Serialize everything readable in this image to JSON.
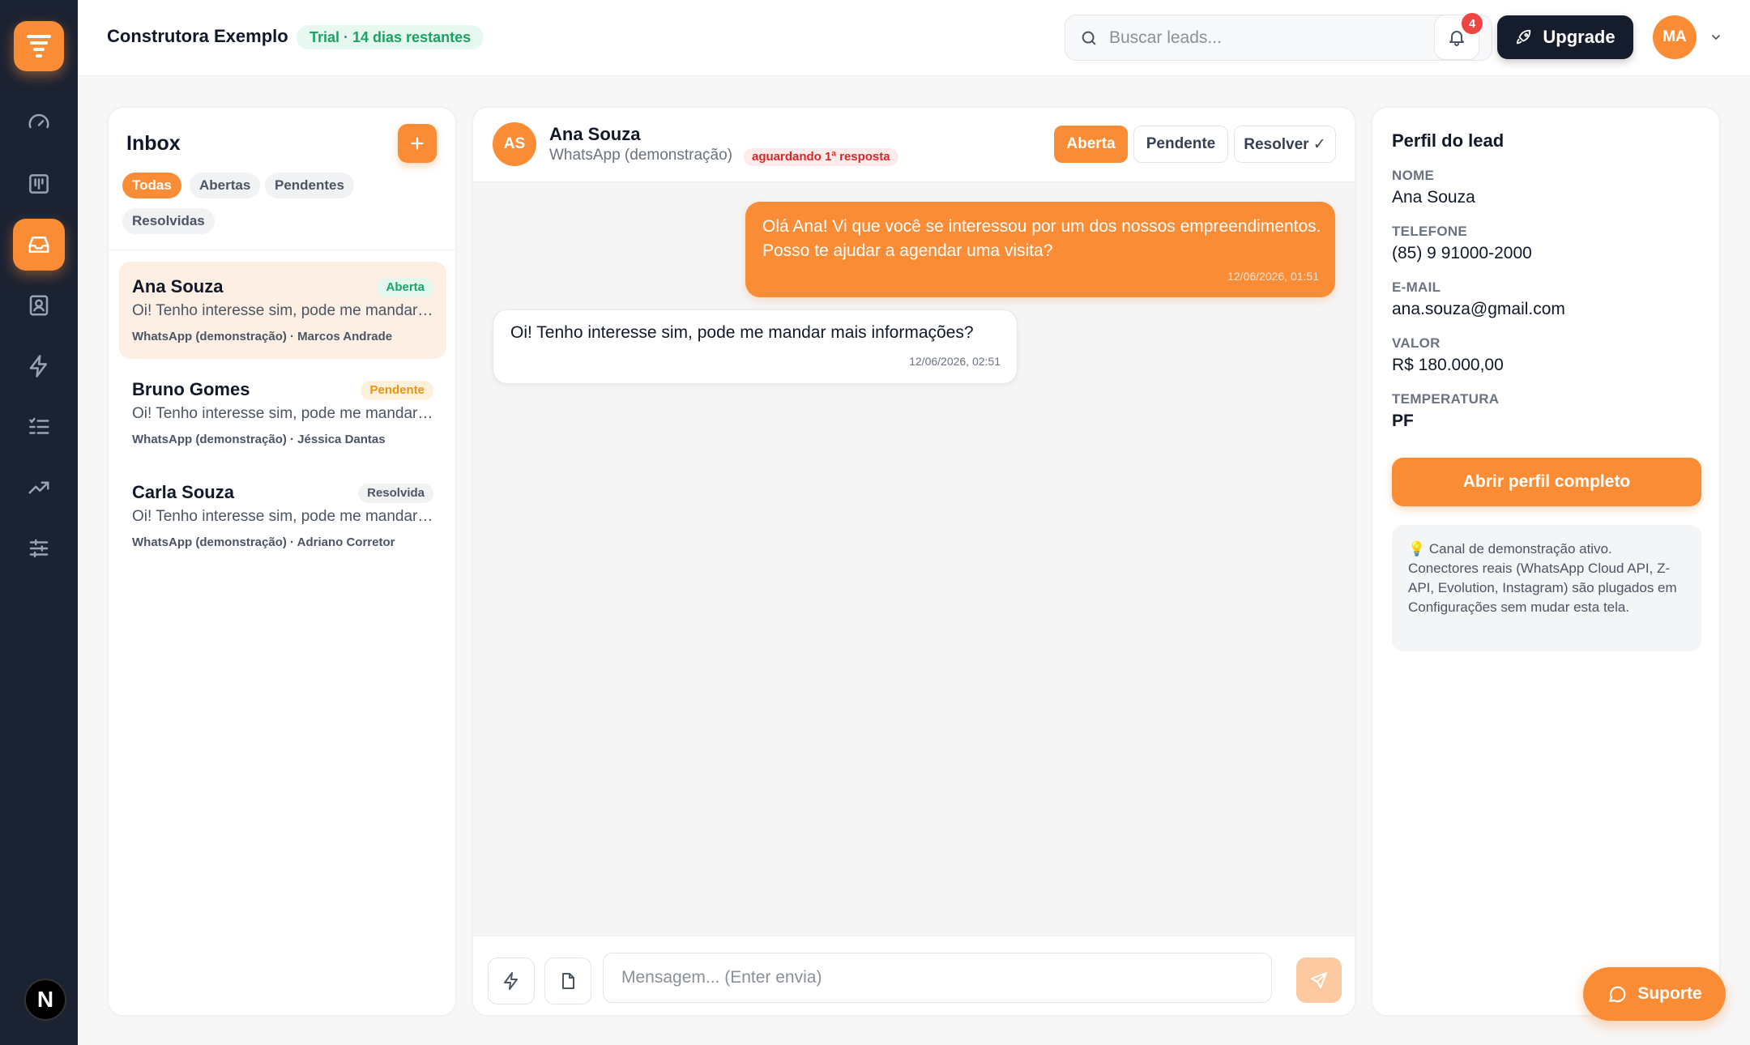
{
  "header": {
    "company": "Construtora Exemplo",
    "trial_badge": "Trial · 14 dias restantes",
    "search_placeholder": "Buscar leads...",
    "notifications_count": "4",
    "upgrade_label": "Upgrade",
    "user_initials": "MA"
  },
  "sidebar": {
    "items": [
      {
        "icon": "gauge-icon"
      },
      {
        "icon": "kanban-icon"
      },
      {
        "icon": "inbox-icon",
        "active": true
      },
      {
        "icon": "contacts-icon"
      },
      {
        "icon": "lightning-icon"
      },
      {
        "icon": "checklist-icon"
      },
      {
        "icon": "trending-up-icon"
      },
      {
        "icon": "sliders-icon"
      }
    ],
    "bottom_badge": "N"
  },
  "inbox": {
    "title": "Inbox",
    "filters": [
      "Todas",
      "Abertas",
      "Pendentes",
      "Resolvidas"
    ],
    "active_filter": "Todas",
    "conversations": [
      {
        "name": "Ana Souza",
        "status": "Aberta",
        "preview": "Oi! Tenho interesse sim, pode me mandar mais informações?",
        "meta": "WhatsApp (demonstração) · Marcos Andrade"
      },
      {
        "name": "Bruno Gomes",
        "status": "Pendente",
        "preview": "Oi! Tenho interesse sim, pode me mandar mais informações?",
        "meta": "WhatsApp (demonstração) · Jéssica Dantas"
      },
      {
        "name": "Carla Souza",
        "status": "Resolvida",
        "preview": "Oi! Tenho interesse sim, pode me mandar mais informações?",
        "meta": "WhatsApp (demonstração) · Adriano Corretor"
      }
    ]
  },
  "chat": {
    "avatar_initials": "AS",
    "contact_name": "Ana Souza",
    "channel": "WhatsApp (demonstração)",
    "awaiting_badge": "aguardando 1ª resposta",
    "status_buttons": [
      "Aberta",
      "Pendente",
      "Resolver ✓"
    ],
    "messages": [
      {
        "direction": "out",
        "text": "Olá Ana! Vi que você se interessou por um dos nossos empreendimentos. Posso te ajudar a agendar uma visita?",
        "time": "12/06/2026, 01:51"
      },
      {
        "direction": "in",
        "text": "Oi! Tenho interesse sim, pode me mandar mais informações?",
        "time": "12/06/2026, 02:51"
      }
    ],
    "composer_placeholder": "Mensagem... (Enter envia)"
  },
  "profile": {
    "title": "Perfil do lead",
    "fields": [
      {
        "label": "NOME",
        "value": "Ana Souza"
      },
      {
        "label": "TELEFONE",
        "value": "(85) 9 91000-2000"
      },
      {
        "label": "E-MAIL",
        "value": "ana.souza@gmail.com"
      },
      {
        "label": "VALOR",
        "value": "R$ 180.000,00"
      },
      {
        "label": "TEMPERATURA",
        "value": "PF"
      }
    ],
    "open_button": "Abrir perfil completo",
    "note_icon": "💡",
    "note": "Canal de demonstração ativo. Conectores reais (WhatsApp Cloud API, Z-API, Evolution, Instagram) são plugados em Configurações sem mudar esta tela."
  },
  "support_label": "Suporte",
  "colors": {
    "accent": "#fb8c36",
    "sidebar": "#1b2232",
    "dark_button": "#151c2b"
  }
}
